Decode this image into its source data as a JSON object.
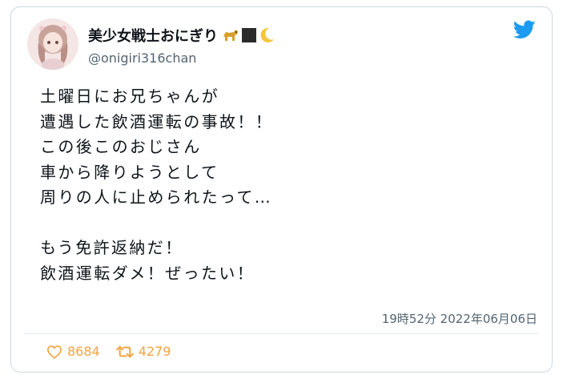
{
  "user": {
    "display_name": "美少女戦士おにぎり",
    "handle": "@onigiri316chan",
    "name_emojis": [
      "dog-emoji",
      "black-square-emoji",
      "crescent-moon-emoji"
    ]
  },
  "tweet": {
    "lines": [
      "土曜日にお兄ちゃんが",
      "遭遇した飲酒運転の事故！！",
      "この後このおじさん",
      "車から降りようとして",
      "周りの人に止められたって…",
      "",
      "もう免許返納だ！",
      "飲酒運転ダメ！ぜったい！"
    ],
    "timestamp": "19時52分 2022年06月06日"
  },
  "stats": {
    "likes": "8684",
    "retweets": "4279"
  },
  "colors": {
    "twitter_blue": "#1d9bf0",
    "action_orange": "#f4a341",
    "secondary_text": "#536471"
  }
}
